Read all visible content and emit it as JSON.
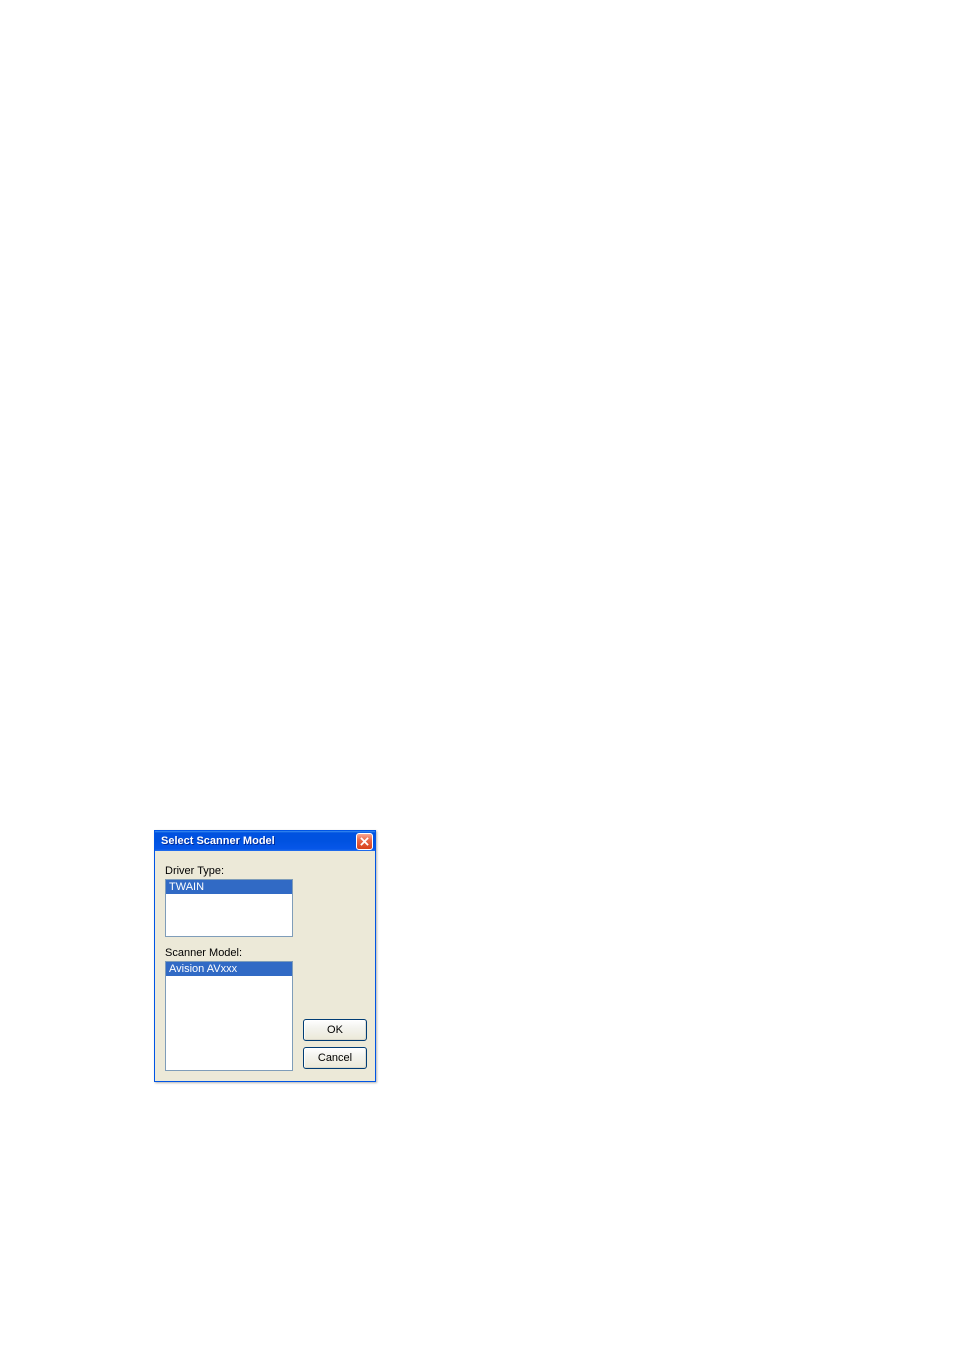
{
  "dialog": {
    "title": "Select Scanner Model",
    "driver_type_label": "Driver Type:",
    "scanner_model_label": "Scanner Model:",
    "driver_types": [
      {
        "name": "TWAIN",
        "selected": true
      }
    ],
    "scanner_models": [
      {
        "name": "Avision AVxxx",
        "selected": true
      }
    ],
    "ok_label": "OK",
    "cancel_label": "Cancel"
  }
}
